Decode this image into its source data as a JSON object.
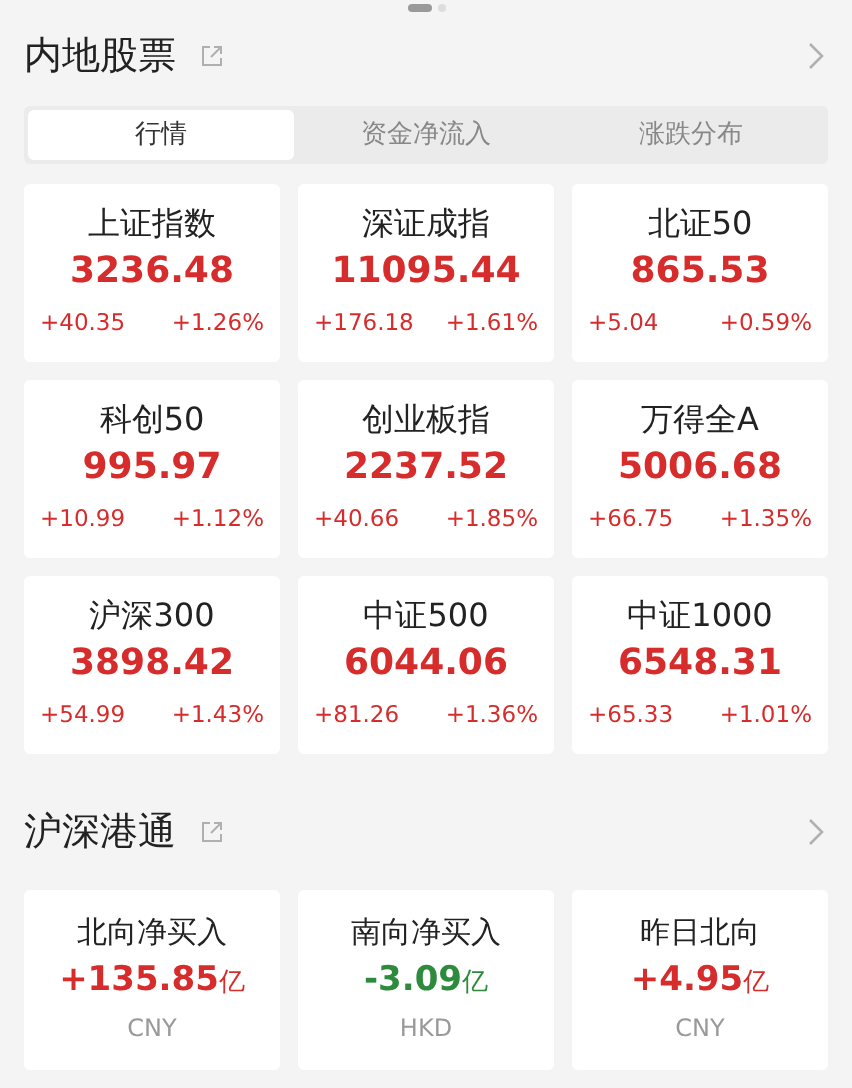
{
  "pager": [
    {
      "selected": true
    },
    {
      "selected": false
    }
  ],
  "mainland": {
    "title": "内地股票",
    "tabs": [
      {
        "label": "行情",
        "selected": true
      },
      {
        "label": "资金净流入",
        "selected": false
      },
      {
        "label": "涨跌分布",
        "selected": false
      }
    ],
    "indices": [
      {
        "name": "上证指数",
        "price": "3236.48",
        "change": "+40.35",
        "percent": "+1.26%",
        "color": "#d62c2c"
      },
      {
        "name": "深证成指",
        "price": "11095.44",
        "change": "+176.18",
        "percent": "+1.61%",
        "color": "#d62c2c"
      },
      {
        "name": "北证50",
        "price": "865.53",
        "change": "+5.04",
        "percent": "+0.59%",
        "color": "#d62c2c"
      },
      {
        "name": "科创50",
        "price": "995.97",
        "change": "+10.99",
        "percent": "+1.12%",
        "color": "#d62c2c"
      },
      {
        "name": "创业板指",
        "price": "2237.52",
        "change": "+40.66",
        "percent": "+1.85%",
        "color": "#d62c2c"
      },
      {
        "name": "万得全A",
        "price": "5006.68",
        "change": "+66.75",
        "percent": "+1.35%",
        "color": "#d62c2c"
      },
      {
        "name": "沪深300",
        "price": "3898.42",
        "change": "+54.99",
        "percent": "+1.43%",
        "color": "#d62c2c"
      },
      {
        "name": "中证500",
        "price": "6044.06",
        "change": "+81.26",
        "percent": "+1.36%",
        "color": "#d62c2c"
      },
      {
        "name": "中证1000",
        "price": "6548.31",
        "change": "+65.33",
        "percent": "+1.01%",
        "color": "#d62c2c"
      }
    ]
  },
  "connect": {
    "title": "沪深港通",
    "flows": [
      {
        "name": "北向净买入",
        "value": "+135.85",
        "unit": "亿",
        "currency": "CNY",
        "color": "#d62c2c"
      },
      {
        "name": "南向净买入",
        "value": "-3.09",
        "unit": "亿",
        "currency": "HKD",
        "color": "#2e8b3e"
      },
      {
        "name": "昨日北向",
        "value": "+4.95",
        "unit": "亿",
        "currency": "CNY",
        "color": "#d62c2c"
      }
    ]
  }
}
